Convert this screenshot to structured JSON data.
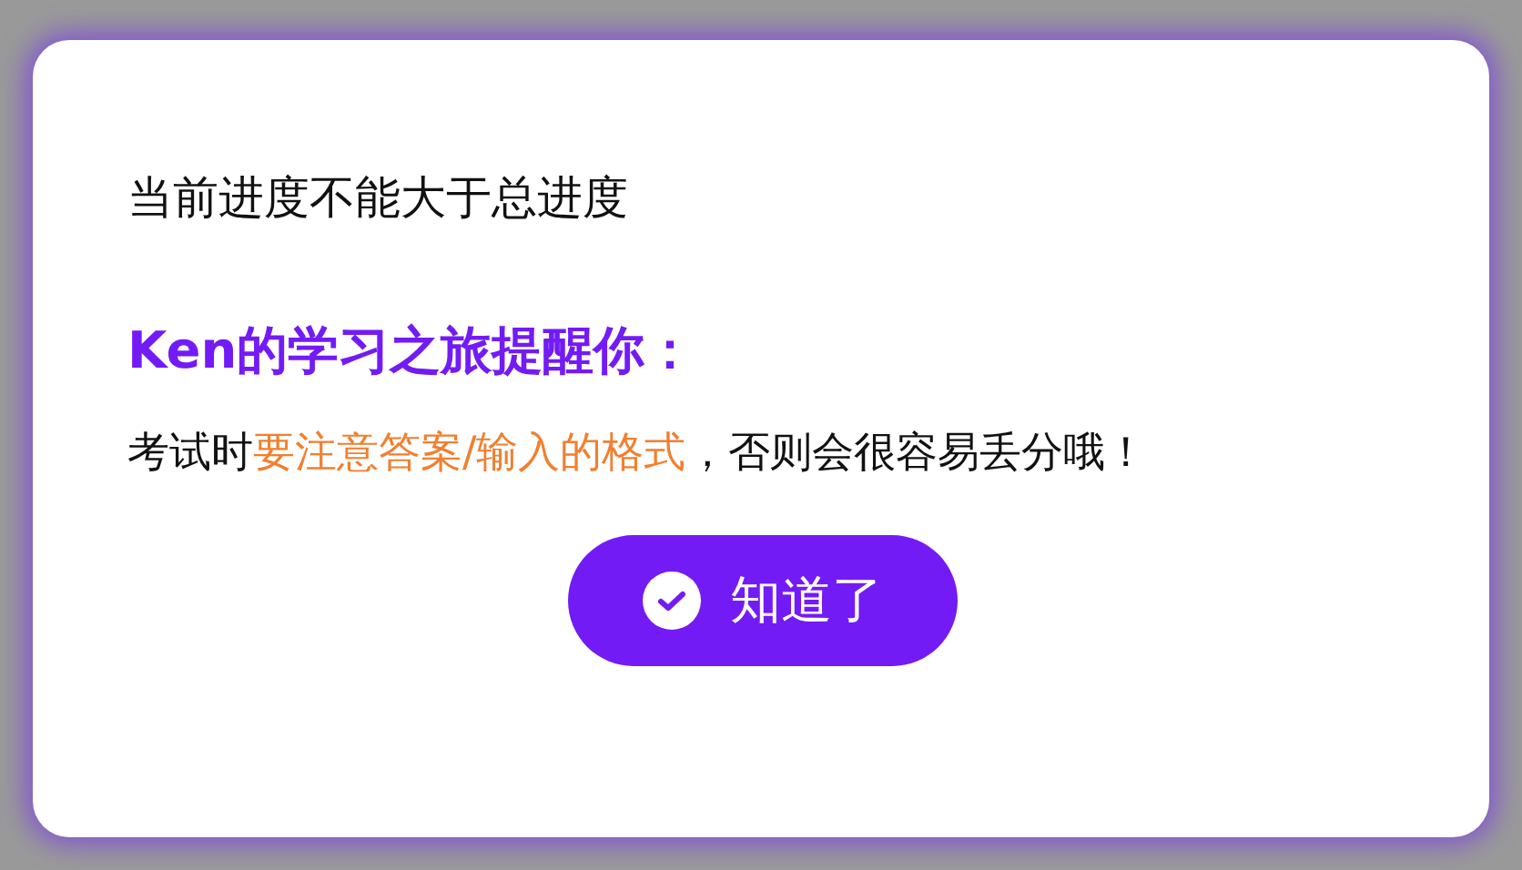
{
  "dialog": {
    "message": "当前进度不能大于总进度",
    "tip_title": "Ken的学习之旅提醒你：",
    "tip_body": [
      {
        "text": "考试时",
        "highlight": false
      },
      {
        "text": "要注意答案/输入的格式",
        "highlight": true
      },
      {
        "text": "，否则会很容易丢分哦！",
        "highlight": false
      }
    ],
    "button": {
      "label": "知道了"
    }
  }
}
